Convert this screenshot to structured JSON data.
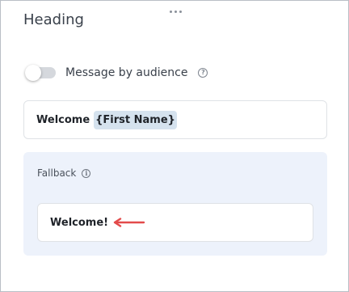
{
  "panel": {
    "heading": "Heading"
  },
  "audience_toggle": {
    "label": "Message by audience",
    "state": "off",
    "help_icon": "question-circle-icon",
    "help_glyph": "?"
  },
  "message": {
    "text": "Welcome",
    "token": "{First Name}"
  },
  "fallback": {
    "label": "Fallback",
    "info_icon": "info-circle-icon",
    "info_glyph": "i",
    "text": "Welcome!",
    "annotation_arrow_color": "#e34b4b"
  },
  "colors": {
    "fallback_background": "#edf2fb",
    "token_background": "#d5e2ee",
    "toggle_track_off": "#d5d8dd"
  }
}
